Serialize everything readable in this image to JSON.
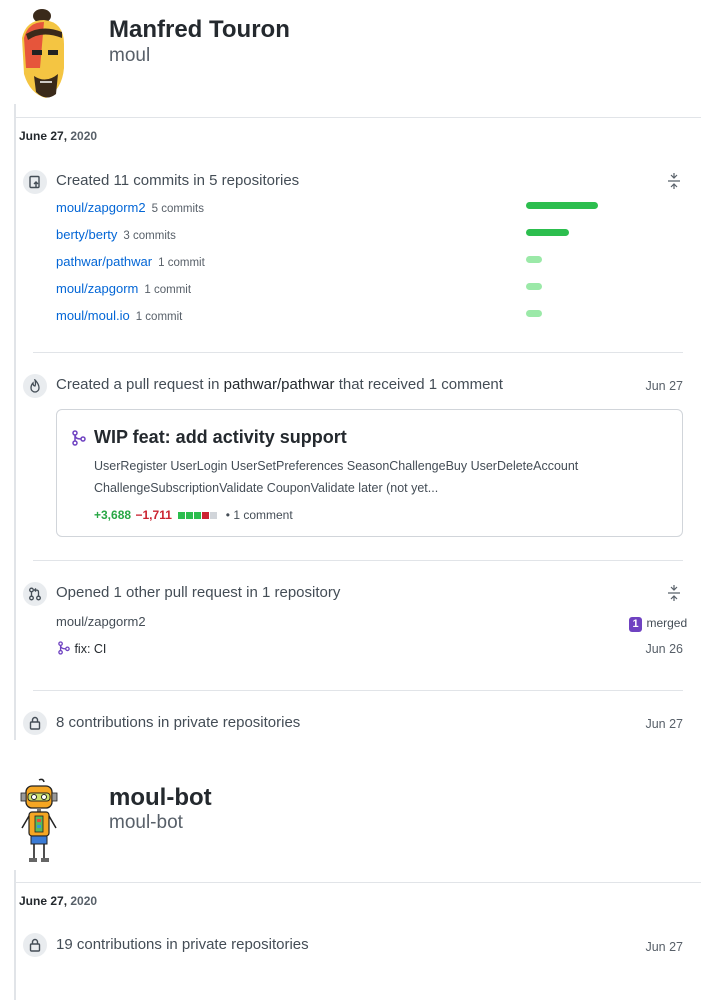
{
  "users": [
    {
      "name": "Manfred Touron",
      "login": "moul",
      "date": "June 27,",
      "year": "2020",
      "commits_event": {
        "title": "Created 11 commits in 5 repositories",
        "repos": [
          {
            "name": "moul/zapgorm2",
            "count": "5 commits",
            "bar_fraction": 1.0
          },
          {
            "name": "berty/berty",
            "count": "3 commits",
            "bar_fraction": 0.6
          },
          {
            "name": "pathwar/pathwar",
            "count": "1 commit",
            "bar_fraction": 0.2
          },
          {
            "name": "moul/zapgorm",
            "count": "1 commit",
            "bar_fraction": 0.2
          },
          {
            "name": "moul/moul.io",
            "count": "1 commit",
            "bar_fraction": 0.2
          }
        ]
      },
      "pr_event": {
        "title_prefix": "Created a pull request in",
        "repo": "pathwar/pathwar",
        "title_suffix": "that received 1 comment",
        "date": "Jun 27",
        "card": {
          "title": "WIP feat: add activity support",
          "body_line1": "UserRegister UserLogin UserSetPreferences SeasonChallengeBuy UserDeleteAccount",
          "body_line2": "ChallengeSubscriptionValidate CouponValidate later (not yet...",
          "additions": "+3,688",
          "deletions": "−1,711",
          "comments": "• 1 comment"
        }
      },
      "opened_event": {
        "title": "Opened 1 other pull request in 1 repository",
        "repo": "moul/zapgorm2",
        "badge_count": "1",
        "badge_label": "merged",
        "pr_title": "fix: CI",
        "pr_date": "Jun 26"
      },
      "private_event": {
        "title": "8 contributions in private repositories",
        "date": "Jun 27"
      }
    },
    {
      "name": "moul-bot",
      "login": "moul-bot",
      "date": "June 27,",
      "year": "2020",
      "private_event": {
        "title": "19 contributions in private repositories",
        "date": "Jun 27"
      }
    }
  ],
  "colors": {
    "bar_dark": "#2cbe4e",
    "bar_light": "#9be9a8",
    "link": "#0366d6",
    "merged": "#6f42c1"
  }
}
